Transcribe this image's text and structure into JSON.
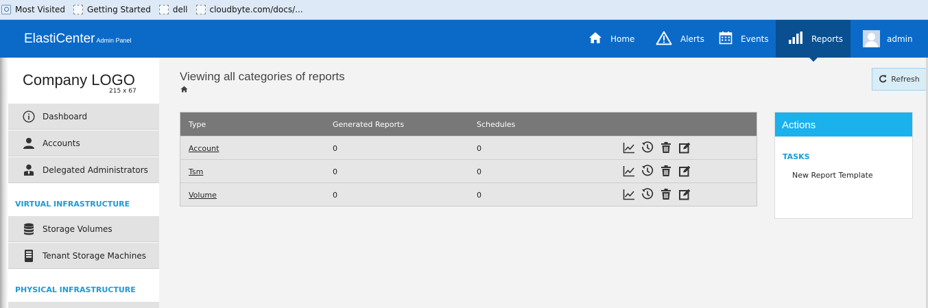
{
  "bookmarks": [
    "Most Visited",
    "Getting Started",
    "dell",
    "cloudbyte.com/docs/..."
  ],
  "header": {
    "brand": "ElastiCenter",
    "brand_sub": "Admin Panel",
    "nav": {
      "home": "Home",
      "alerts": "Alerts",
      "events": "Events",
      "reports": "Reports",
      "user": "admin"
    },
    "active_nav": "Reports"
  },
  "sidebar": {
    "logo_text": "Company LOGO",
    "logo_size": "215 x 67",
    "items": [
      {
        "label": "Dashboard",
        "icon": "info-circle-icon"
      },
      {
        "label": "Accounts",
        "icon": "user-icon"
      },
      {
        "label": "Delegated Administrators",
        "icon": "admin-user-icon"
      },
      {
        "label": "Storage Volumes",
        "icon": "database-icon"
      },
      {
        "label": "Tenant Storage Machines",
        "icon": "server-icon"
      }
    ],
    "sections": {
      "virtual": "VIRTUAL INFRASTRUCTURE",
      "physical": "PHYSICAL INFRASTRUCTURE"
    }
  },
  "main": {
    "title": "Viewing all categories of reports",
    "refresh_label": "Refresh",
    "table": {
      "columns": [
        "Type",
        "Generated Reports",
        "Schedules"
      ],
      "rows": [
        {
          "type": "Account",
          "generated": "0",
          "schedules": "0"
        },
        {
          "type": "Tsm",
          "generated": "0",
          "schedules": "0"
        },
        {
          "type": "Volume",
          "generated": "0",
          "schedules": "0"
        }
      ],
      "row_actions": [
        "chart-icon",
        "schedule-icon",
        "trash-icon",
        "edit-icon"
      ]
    }
  },
  "actions_panel": {
    "title": "Actions",
    "tasks_label": "TASKS",
    "task": "New Report Template"
  },
  "colors": {
    "header": "#0b6ac8",
    "active_nav": "#0a4f8f",
    "actions_head": "#1ab1ec",
    "section_label": "#1a9bd7",
    "table_head": "#787878"
  }
}
